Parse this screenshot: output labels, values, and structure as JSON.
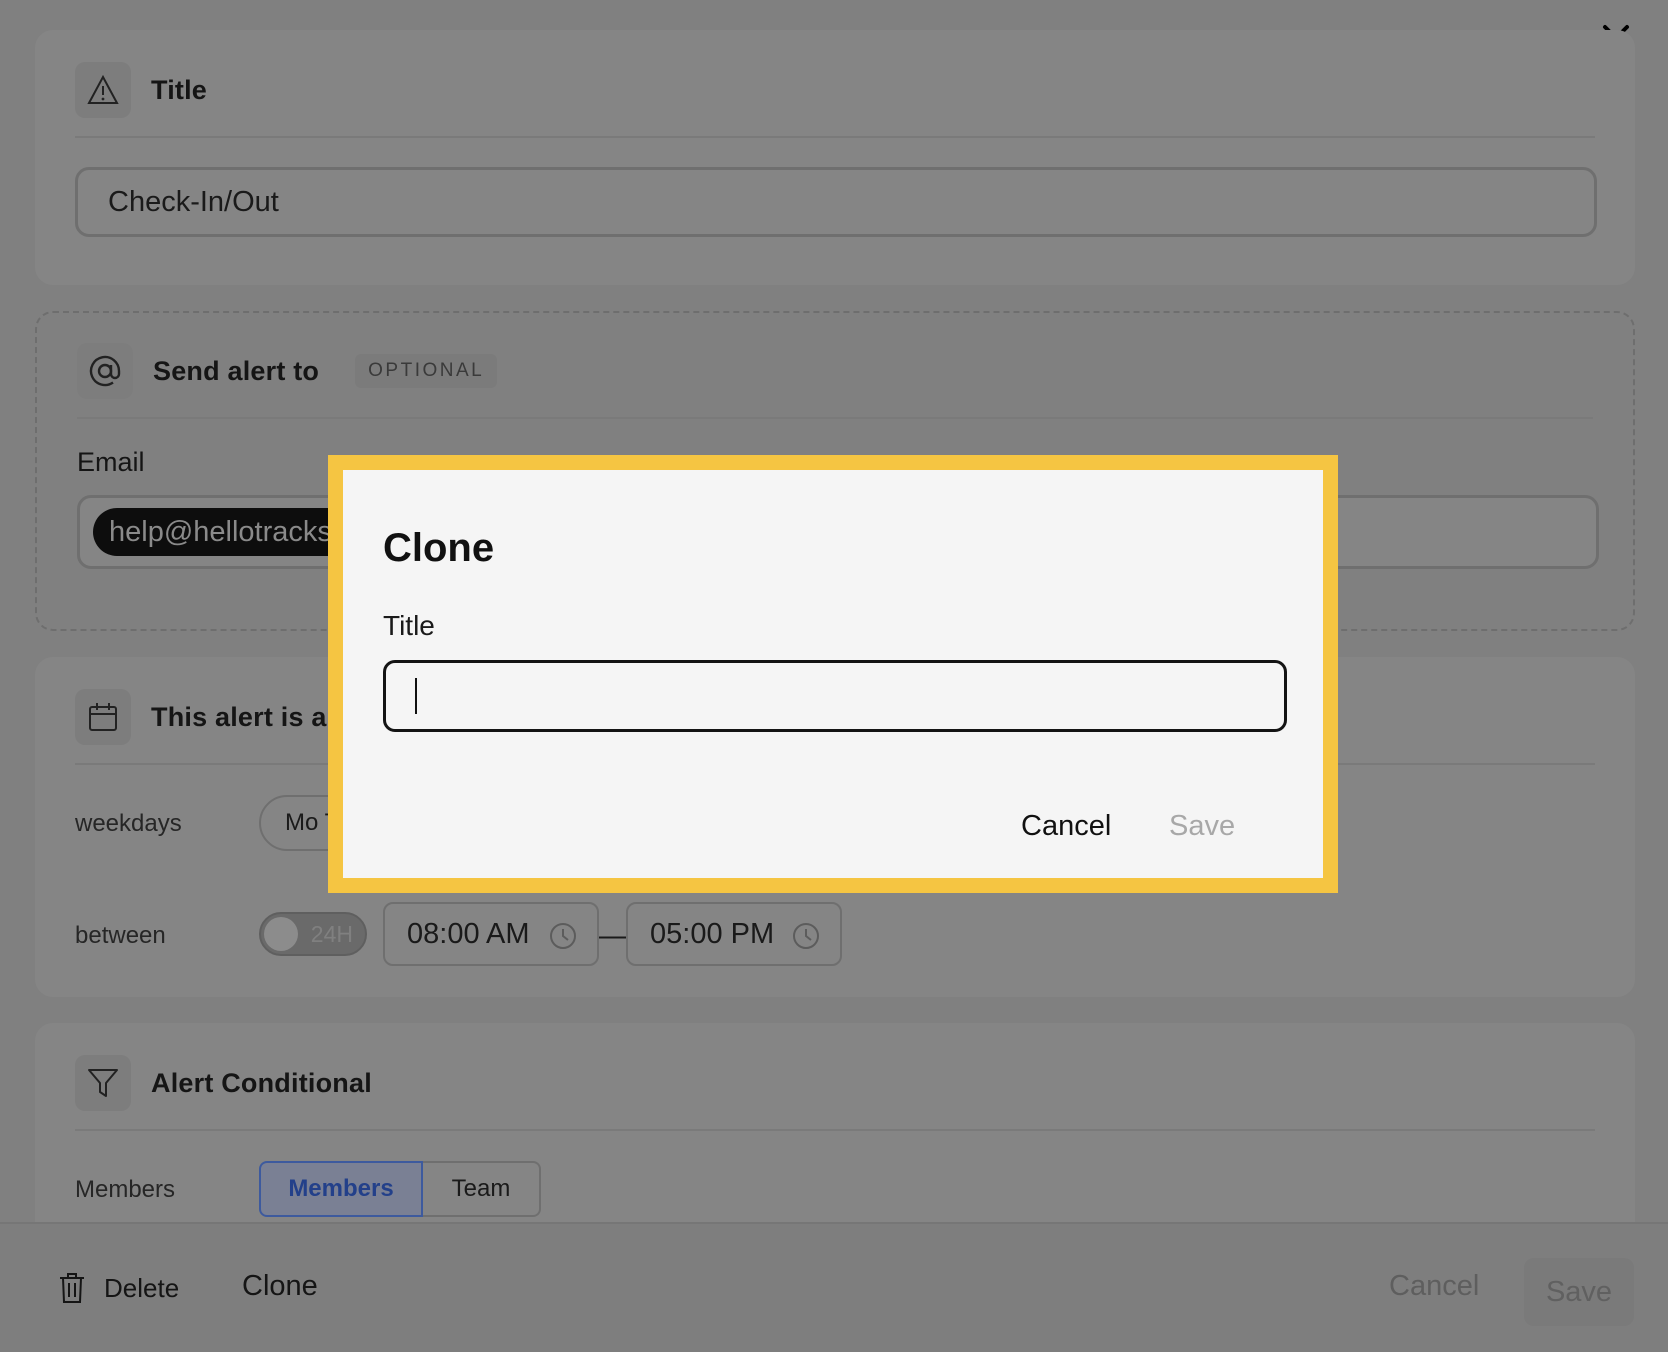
{
  "title_section": {
    "heading": "Title",
    "value": "Check-In/Out"
  },
  "send_alert": {
    "heading": "Send alert to",
    "badge": "OPTIONAL",
    "email_label": "Email",
    "email_chip": "help@hellotracks"
  },
  "schedule": {
    "heading": "This alert is a",
    "weekdays_label": "weekdays",
    "weekdays_value": "Mo T",
    "between_label": "between",
    "toggle_label": "24H",
    "start_time": "08:00 AM",
    "end_time": "05:00 PM",
    "separator": "—"
  },
  "conditional": {
    "heading": "Alert Conditional",
    "members_label": "Members",
    "segments": [
      "Members",
      "Team"
    ]
  },
  "footer": {
    "delete_label": "Delete",
    "clone_label": "Clone",
    "cancel_label": "Cancel",
    "save_label": "Save"
  },
  "dialog": {
    "title": "Clone",
    "field_label": "Title",
    "field_value": "",
    "cancel_label": "Cancel",
    "save_label": "Save"
  },
  "colors": {
    "overlay": "#808080",
    "highlight": "#f5c542",
    "dialog_bg": "#f5f5f5",
    "active_segment": "#3d5a9e"
  }
}
